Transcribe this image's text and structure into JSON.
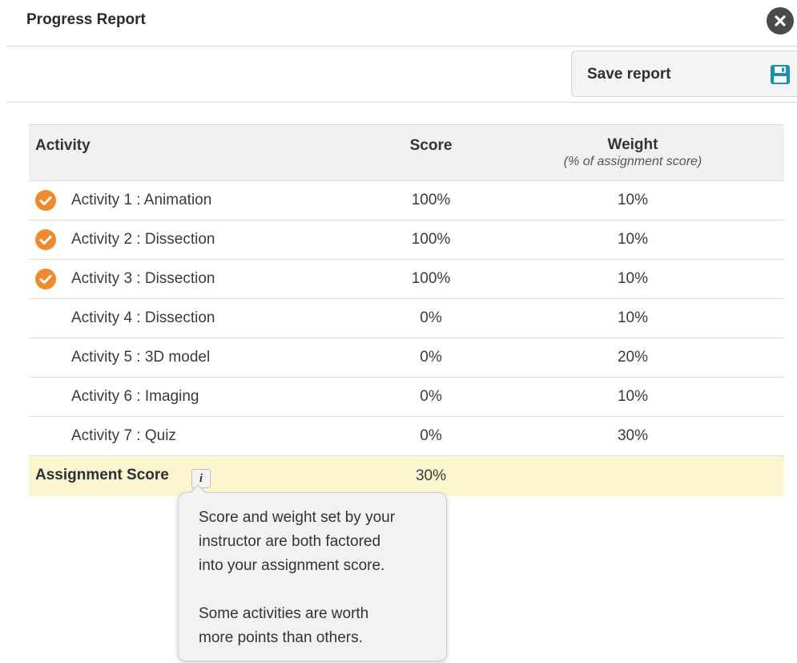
{
  "header": {
    "title": "Progress Report",
    "close_icon": "close-icon"
  },
  "toolbar": {
    "save_label": "Save report",
    "save_icon": "save-icon",
    "save_icon_color": "#1e8fb0"
  },
  "table": {
    "columns": {
      "activity": "Activity",
      "score": "Score",
      "weight": "Weight",
      "weight_sub": "(% of assignment score)"
    },
    "rows": [
      {
        "name": "Activity 1 : Animation",
        "score": "100%",
        "weight": "10%",
        "completed": true
      },
      {
        "name": "Activity 2 : Dissection",
        "score": "100%",
        "weight": "10%",
        "completed": true
      },
      {
        "name": "Activity 3 : Dissection",
        "score": "100%",
        "weight": "10%",
        "completed": true
      },
      {
        "name": "Activity 4 : Dissection",
        "score": "0%",
        "weight": "10%",
        "completed": false
      },
      {
        "name": "Activity 5 : 3D model",
        "score": "0%",
        "weight": "20%",
        "completed": false
      },
      {
        "name": "Activity 6 : Imaging",
        "score": "0%",
        "weight": "10%",
        "completed": false
      },
      {
        "name": "Activity 7 : Quiz",
        "score": "0%",
        "weight": "30%",
        "completed": false
      }
    ],
    "total": {
      "label": "Assignment Score",
      "info_glyph": "i",
      "score": "30%"
    }
  },
  "tooltip": {
    "line1": "Score and weight set by your",
    "line2": "instructor are both factored",
    "line3": "into your assignment score.",
    "line4": "Some activities are worth",
    "line5": "more points than others."
  },
  "colors": {
    "check_orange": "#f08a2c",
    "total_row_bg": "#fbf6cf",
    "header_bg": "#f1f1f1"
  }
}
